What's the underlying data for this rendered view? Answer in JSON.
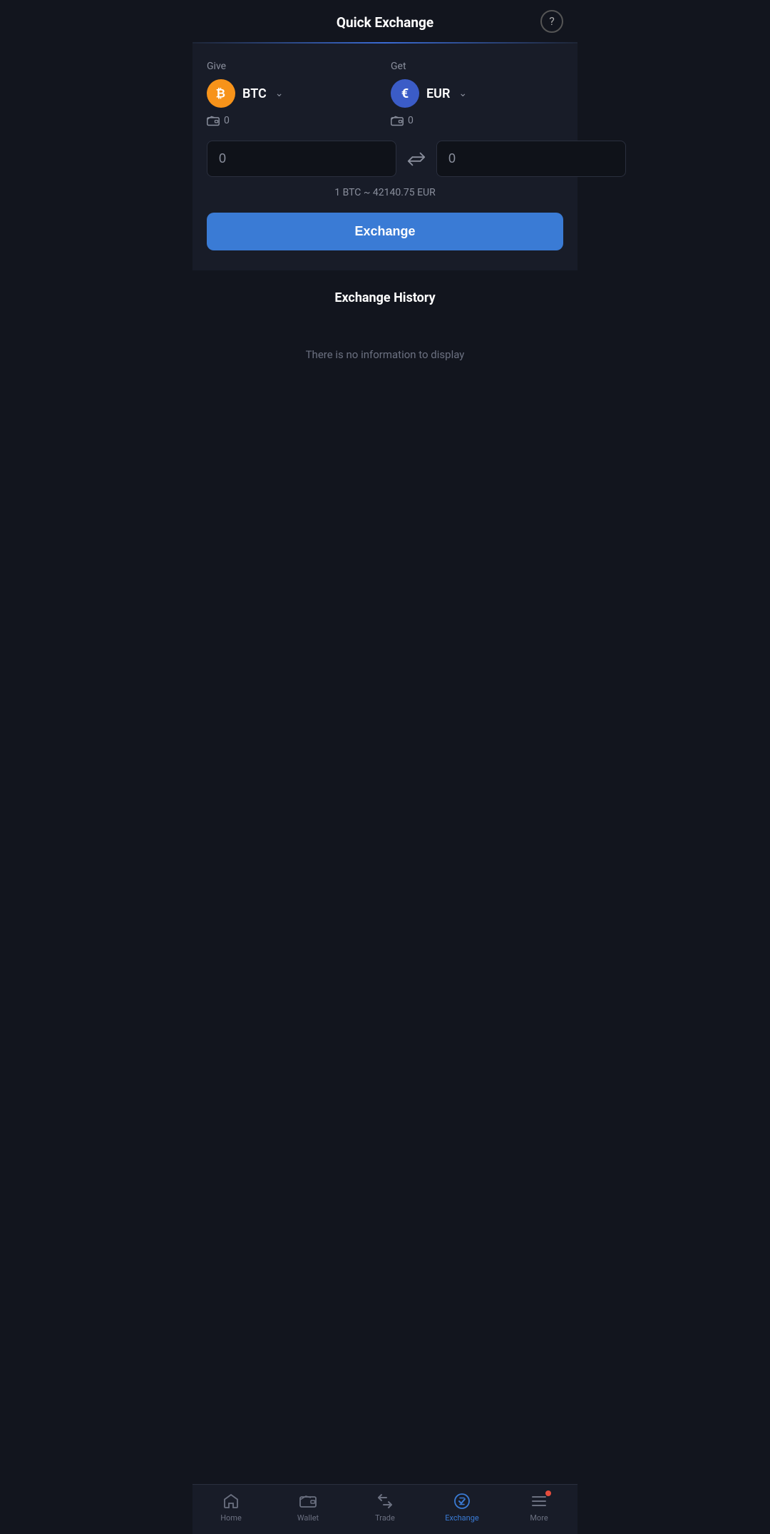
{
  "header": {
    "title": "Quick Exchange",
    "help_label": "?"
  },
  "exchange": {
    "give_label": "Give",
    "get_label": "Get",
    "give_currency": "BTC",
    "get_currency": "EUR",
    "give_balance": "0",
    "get_balance": "0",
    "give_amount_placeholder": "0",
    "get_amount_placeholder": "0",
    "give_amount_value": "",
    "get_amount_value": "",
    "rate_text": "1 BTC ~ 42140.75 EUR",
    "exchange_button_label": "Exchange"
  },
  "history": {
    "title": "Exchange History",
    "empty_text": "There is no information to display"
  },
  "nav": {
    "items": [
      {
        "label": "Home",
        "icon": "home",
        "active": false
      },
      {
        "label": "Wallet",
        "icon": "wallet",
        "active": false
      },
      {
        "label": "Trade",
        "icon": "trade",
        "active": false
      },
      {
        "label": "Exchange",
        "icon": "exchange",
        "active": true
      },
      {
        "label": "More",
        "icon": "more",
        "active": false,
        "dot": true
      }
    ]
  },
  "colors": {
    "accent": "#3a7bd5",
    "btc_bg": "#f7931a",
    "eur_bg": "#3b5cc7",
    "inactive": "#6b7080",
    "notification": "#e74c3c"
  }
}
